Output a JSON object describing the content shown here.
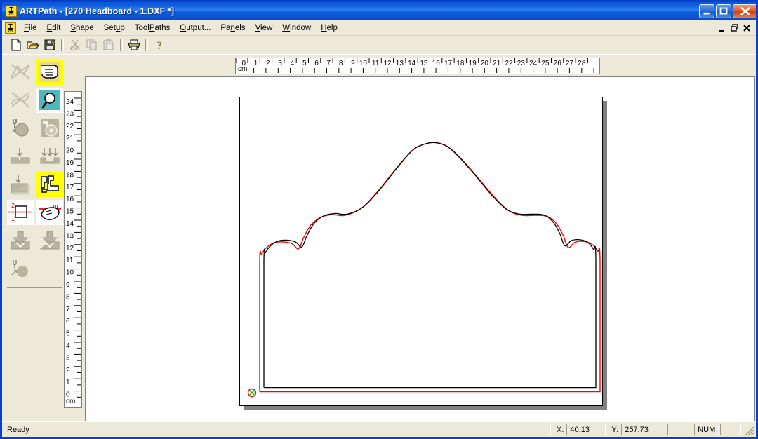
{
  "window": {
    "title": "ARTPath - [270 Headboard - 1.DXF *]",
    "app_icon": "router-bit-icon",
    "minimize_label": "Minimize",
    "maximize_label": "Maximize",
    "close_label": "Close",
    "titlebar_color": "#0a52d8",
    "face_color": "#ece9d8"
  },
  "mdi": {
    "minimize_label": "_",
    "restore_label": "❐",
    "close_label": "✕"
  },
  "menu": {
    "items": [
      {
        "label": "File",
        "accel": "F"
      },
      {
        "label": "Edit",
        "accel": "E"
      },
      {
        "label": "Shape",
        "accel": "S"
      },
      {
        "label": "Setup",
        "accel": "u"
      },
      {
        "label": "ToolPaths",
        "accel": "P"
      },
      {
        "label": "Output...",
        "accel": "O"
      },
      {
        "label": "Panels",
        "accel": "n"
      },
      {
        "label": "View",
        "accel": "V"
      },
      {
        "label": "Window",
        "accel": "W"
      },
      {
        "label": "Help",
        "accel": "H"
      }
    ]
  },
  "toolbar": {
    "buttons": [
      {
        "name": "new-file-icon",
        "label": "New",
        "enabled": true
      },
      {
        "name": "open-file-icon",
        "label": "Open",
        "enabled": true
      },
      {
        "name": "save-file-icon",
        "label": "Save",
        "enabled": true
      },
      {
        "name": "cut-icon",
        "label": "Cut",
        "enabled": false
      },
      {
        "name": "copy-icon",
        "label": "Copy",
        "enabled": false
      },
      {
        "name": "paste-icon",
        "label": "Paste",
        "enabled": false
      },
      {
        "name": "print-icon",
        "label": "Print",
        "enabled": true
      },
      {
        "name": "help-icon",
        "label": "Help",
        "enabled": true
      }
    ]
  },
  "left_toolbar": {
    "tools": [
      {
        "name": "draw-polyline-tool",
        "label": "Draw Shape",
        "enabled": false,
        "selected": false
      },
      {
        "name": "select-pointer-tool",
        "label": "Select",
        "enabled": true,
        "selected": true
      },
      {
        "name": "node-edit-tool",
        "label": "Node Edit",
        "enabled": false,
        "selected": false
      },
      {
        "name": "zoom-tool",
        "label": "Zoom",
        "enabled": true,
        "selected": true
      },
      {
        "name": "drill-tool",
        "label": "Drill",
        "enabled": true,
        "selected": false
      },
      {
        "name": "pocket-region-tool",
        "label": "Pocket Region",
        "enabled": true,
        "selected": false
      },
      {
        "name": "single-plunge-tool",
        "label": "Single Plunge",
        "enabled": true,
        "selected": false
      },
      {
        "name": "multi-plunge-tool",
        "label": "Multi Plunge",
        "enabled": true,
        "selected": false
      },
      {
        "name": "pocket-tool",
        "label": "Pocket",
        "enabled": true,
        "selected": false
      },
      {
        "name": "nesting-tool",
        "label": "Nesting",
        "enabled": true,
        "selected": true
      },
      {
        "name": "sequence-order-tool",
        "label": "Cut Sequence",
        "enabled": true,
        "selected": false
      },
      {
        "name": "tabs-bridges-tool",
        "label": "Tabs / Bridges",
        "enabled": true,
        "selected": false
      },
      {
        "name": "lead-in-tool",
        "label": "Lead In",
        "enabled": true,
        "selected": false
      },
      {
        "name": "lead-out-tool",
        "label": "Lead Out",
        "enabled": true,
        "selected": false
      },
      {
        "name": "tool-start-point-tool",
        "label": "Start Point",
        "enabled": true,
        "selected": false
      }
    ]
  },
  "rulers": {
    "unit": "cm",
    "horizontal": {
      "labels": [
        "0",
        "1",
        "2",
        "3",
        "4",
        "5",
        "6",
        "7",
        "8",
        "9",
        "10",
        "11",
        "12",
        "13",
        "14",
        "15",
        "16",
        "17",
        "18",
        "19",
        "20",
        "21",
        "22",
        "23",
        "24",
        "25",
        "26",
        "27",
        "28"
      ],
      "min": 0,
      "max": 28
    },
    "vertical": {
      "labels": [
        "24",
        "23",
        "22",
        "21",
        "20",
        "19",
        "18",
        "17",
        "16",
        "15",
        "14",
        "13",
        "12",
        "11",
        "10",
        "9",
        "8",
        "7",
        "6",
        "5",
        "4",
        "3",
        "2",
        "1",
        "0"
      ],
      "min": 0,
      "max": 24
    }
  },
  "drawing": {
    "part_name": "270 Headboard",
    "sheet_outline_color": "#000000",
    "geometry_color": "#000000",
    "toolpath_color": "#ff0000",
    "origin_marker_color": "#00c000",
    "origin_label": "origin-marker"
  },
  "status": {
    "message": "Ready",
    "x_label": "X:",
    "x_value": "40.13",
    "y_label": "Y:",
    "y_value": "257.73",
    "indicator_blank_1": "",
    "indicator_num": "NUM",
    "indicator_blank_2": ""
  },
  "chart_data": {
    "type": "line",
    "title": "270 Headboard - 1.DXF",
    "xlabel": "cm",
    "ylabel": "cm",
    "xlim": [
      0,
      28
    ],
    "ylim": [
      0,
      24
    ],
    "grid": false,
    "legend": "none",
    "series": [
      {
        "name": "part-outline",
        "color": "#000000",
        "points": [
          [
            1.3,
            0.6
          ],
          [
            1.3,
            11.0
          ],
          [
            1.45,
            11.75
          ],
          [
            1.9,
            12.35
          ],
          [
            2.5,
            12.7
          ],
          [
            3.2,
            12.75
          ],
          [
            3.85,
            12.6
          ],
          [
            4.35,
            12.2
          ],
          [
            4.75,
            13.1
          ],
          [
            5.3,
            14.1
          ],
          [
            6.1,
            14.75
          ],
          [
            7.0,
            14.95
          ],
          [
            8.0,
            14.9
          ],
          [
            9.3,
            15.5
          ],
          [
            10.6,
            16.9
          ],
          [
            12.0,
            18.7
          ],
          [
            13.2,
            20.1
          ],
          [
            14.0,
            20.6
          ],
          [
            15.0,
            20.8
          ],
          [
            16.0,
            20.5
          ],
          [
            17.0,
            19.6
          ],
          [
            18.3,
            18.1
          ],
          [
            19.6,
            16.5
          ],
          [
            20.8,
            15.3
          ],
          [
            21.9,
            14.9
          ],
          [
            23.0,
            14.9
          ],
          [
            23.9,
            14.8
          ],
          [
            24.6,
            14.2
          ],
          [
            25.1,
            13.3
          ],
          [
            25.5,
            12.3
          ],
          [
            26.0,
            12.7
          ],
          [
            26.6,
            12.8
          ],
          [
            27.3,
            12.6
          ],
          [
            27.8,
            12.0
          ],
          [
            28.0,
            11.2
          ],
          [
            28.0,
            0.6
          ],
          [
            1.3,
            0.6
          ]
        ]
      },
      {
        "name": "offset-toolpath",
        "color": "#ff0000",
        "offset_mm": 6,
        "side": "outside"
      }
    ]
  }
}
